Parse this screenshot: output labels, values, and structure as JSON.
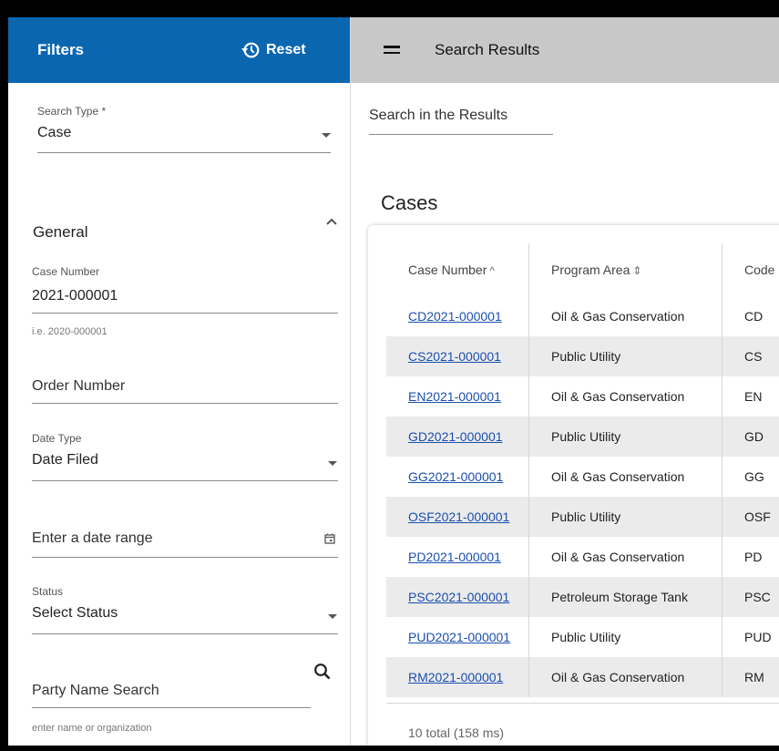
{
  "sidebar": {
    "title": "Filters",
    "reset_label": "Reset",
    "search_type": {
      "label": "Search Type *",
      "value": "Case"
    },
    "general_section": {
      "label": "General"
    },
    "case_number": {
      "label": "Case Number",
      "value": "2021-000001",
      "hint": "i.e. 2020-000001"
    },
    "order_number": {
      "placeholder": "Order Number"
    },
    "date_type": {
      "label": "Date Type",
      "value": "Date Filed"
    },
    "date_range": {
      "placeholder": "Enter a date range"
    },
    "status": {
      "label": "Status",
      "value": "Select Status"
    },
    "party_name": {
      "placeholder": "Party Name Search",
      "hint": "enter name or organization"
    }
  },
  "results": {
    "title": "Search Results",
    "search_placeholder": "Search in the Results",
    "cases_heading": "Cases",
    "columns": [
      "Case Number",
      "Program Area",
      "Code"
    ],
    "rows": [
      {
        "case": "CD2021-000001",
        "area": "Oil & Gas Conservation",
        "code": "CD"
      },
      {
        "case": "CS2021-000001",
        "area": "Public Utility",
        "code": "CS"
      },
      {
        "case": "EN2021-000001",
        "area": "Oil & Gas Conservation",
        "code": "EN"
      },
      {
        "case": "GD2021-000001",
        "area": "Public Utility",
        "code": "GD"
      },
      {
        "case": "GG2021-000001",
        "area": "Oil & Gas Conservation",
        "code": "GG"
      },
      {
        "case": "OSF2021-000001",
        "area": "Public Utility",
        "code": "OSF"
      },
      {
        "case": "PD2021-000001",
        "area": "Oil & Gas Conservation",
        "code": "PD"
      },
      {
        "case": "PSC2021-000001",
        "area": "Petroleum Storage Tank",
        "code": "PSC"
      },
      {
        "case": "PUD2021-000001",
        "area": "Public Utility",
        "code": "PUD"
      },
      {
        "case": "RM2021-000001",
        "area": "Oil & Gas Conservation",
        "code": "RM"
      }
    ],
    "footer": "10 total (158 ms)"
  },
  "colors": {
    "header_blue": "#0b66b0",
    "results_header_gray": "#c8c8c8",
    "link": "#1a4fb0"
  }
}
